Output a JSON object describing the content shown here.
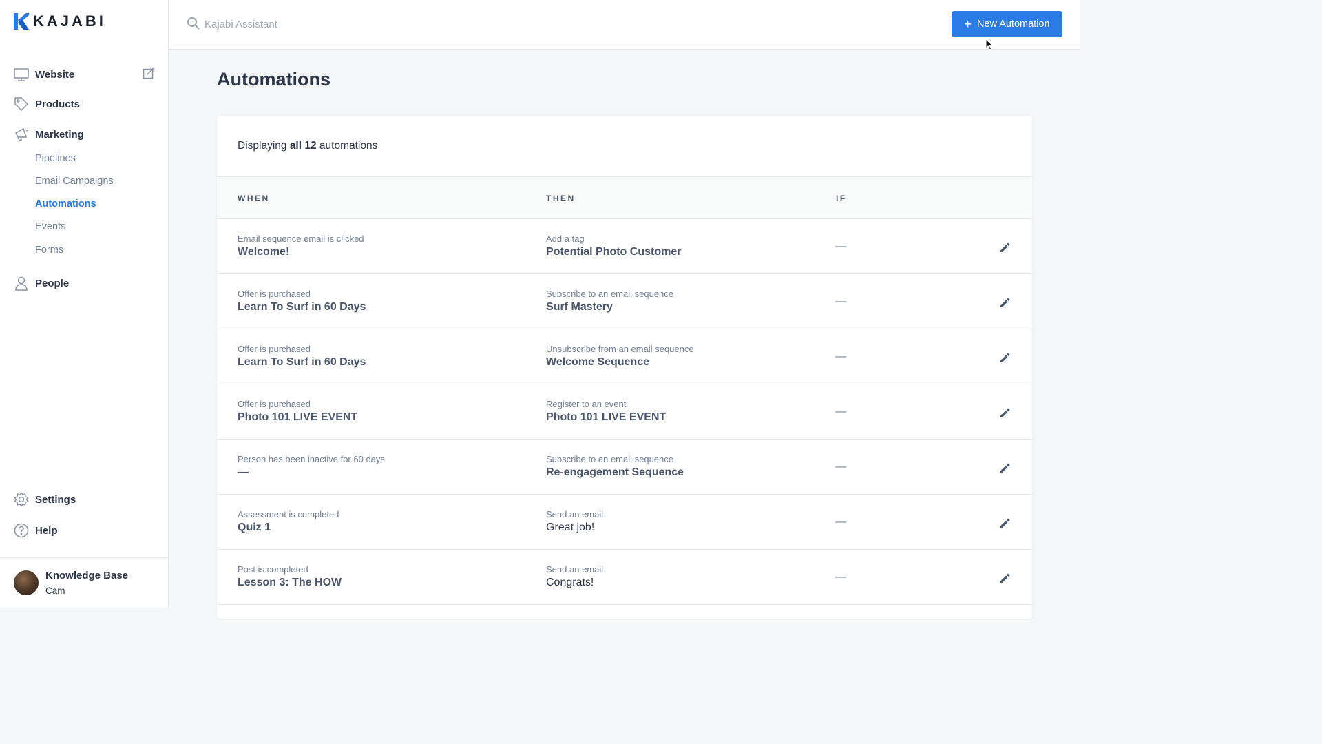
{
  "brand": {
    "name": "KAJABI",
    "color": "#2b7be4"
  },
  "sidebar": {
    "items": [
      {
        "label": "Website",
        "icon": "monitor-icon"
      },
      {
        "label": "Products",
        "icon": "tag-icon"
      },
      {
        "label": "Marketing",
        "icon": "megaphone-icon"
      },
      {
        "label": "People",
        "icon": "person-icon"
      },
      {
        "label": "Settings",
        "icon": "gear-icon"
      },
      {
        "label": "Help",
        "icon": "help-icon"
      }
    ],
    "marketing_sub": [
      "Pipelines",
      "Email Campaigns",
      "Automations",
      "Events",
      "Forms"
    ],
    "active_sub": "Automations",
    "user": {
      "name": "Knowledge Base",
      "sub": "Cam"
    }
  },
  "header": {
    "search_placeholder": "Kajabi Assistant",
    "new_button_label": "New Automation"
  },
  "main": {
    "title": "Automations",
    "summary": {
      "prefix": "Displaying ",
      "bold": "all 12",
      "suffix": " automations"
    },
    "columns": [
      "WHEN",
      "THEN",
      "IF"
    ],
    "rows": [
      {
        "when_small": "Email sequence email is clicked",
        "when_big": "Welcome!",
        "then_small": "Add a tag",
        "then_big": "Potential Photo Customer",
        "if": "—"
      },
      {
        "when_small": "Offer is purchased",
        "when_big": "Learn To Surf in 60 Days",
        "then_small": "Subscribe to an email sequence",
        "then_big": "Surf Mastery",
        "if": "—"
      },
      {
        "when_small": "Offer is purchased",
        "when_big": "Learn To Surf in 60 Days",
        "then_small": "Unsubscribe from an email sequence",
        "then_big": "Welcome Sequence",
        "if": "—"
      },
      {
        "when_small": "Offer is purchased",
        "when_big": "Photo 101 LIVE EVENT",
        "then_small": "Register to an event",
        "then_big": "Photo 101 LIVE EVENT",
        "if": "—"
      },
      {
        "when_small": "Person has been inactive for 60 days",
        "when_big": "—",
        "then_small": "Subscribe to an email sequence",
        "then_big": "Re-engagement Sequence",
        "if": "—"
      },
      {
        "when_small": "Assessment is completed",
        "when_big": "Quiz 1",
        "then_small": "Send an email",
        "then_big": "Great job!",
        "if": "—"
      },
      {
        "when_small": "Post is completed",
        "when_big": "Lesson 3: The HOW",
        "then_small": "Send an email",
        "then_big": "Congrats!",
        "if": "—"
      }
    ]
  }
}
